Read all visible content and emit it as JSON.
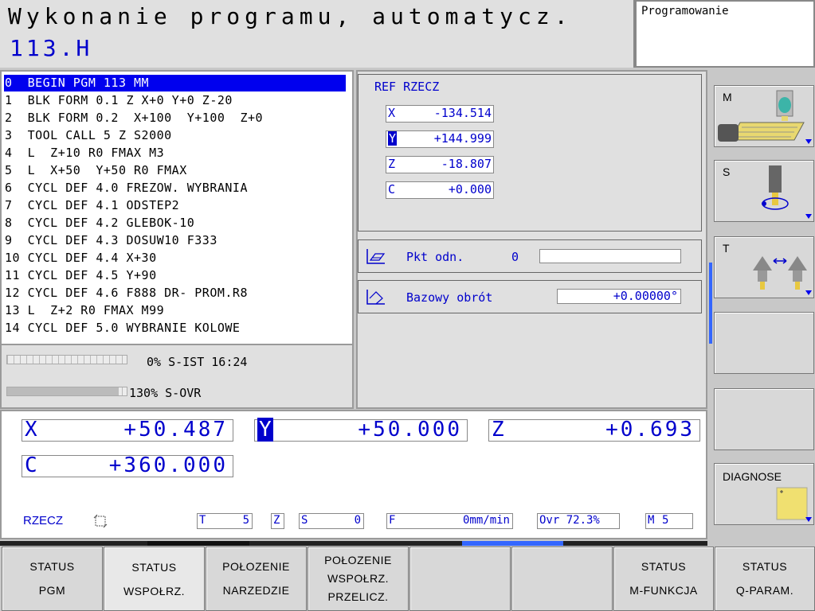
{
  "header": {
    "mode_title": "Wykonanie programu, automatycz.",
    "program_name": "113.H",
    "secondary_mode": "Programowanie"
  },
  "program": {
    "lines": [
      "0  BEGIN PGM 113 MM",
      "1  BLK FORM 0.1 Z X+0 Y+0 Z-20",
      "2  BLK FORM 0.2  X+100  Y+100  Z+0",
      "3  TOOL CALL 5 Z S2000",
      "4  L  Z+10 R0 FMAX M3",
      "5  L  X+50  Y+50 R0 FMAX",
      "6  CYCL DEF 4.0 FREZOW. WYBRANIA",
      "7  CYCL DEF 4.1 ODSTEP2",
      "8  CYCL DEF 4.2 GLEBOK-10",
      "9  CYCL DEF 4.3 DOSUW10 F333",
      "10 CYCL DEF 4.4 X+30",
      "11 CYCL DEF 4.5 Y+90",
      "12 CYCL DEF 4.6 F888 DR- PROM.R8",
      "13 L  Z+2 R0 FMAX M99",
      "14 CYCL DEF 5.0 WYBRANIE KOLOWE"
    ],
    "selected_line": 0
  },
  "progress": {
    "spindle_actual": "0% S-IST 16:24",
    "spindle_actual_fraction": 0.0,
    "spindle_override": "130% S-OVR",
    "spindle_override_fraction": 0.93
  },
  "status": {
    "ref_title": "REF RZECZ",
    "ref_axes": [
      {
        "axis": "X",
        "value": "-134.514"
      },
      {
        "axis": "Y",
        "value": "+144.999"
      },
      {
        "axis": "Z",
        "value": "-18.807"
      },
      {
        "axis": "C",
        "value": "+0.000"
      }
    ],
    "datum_label": "Pkt odn.",
    "datum_number": "0",
    "datum_value": "",
    "rotation_label": "Bazowy obrót",
    "rotation_value": "+0.00000°"
  },
  "position": {
    "axes": [
      {
        "axis": "X",
        "value": "+50.487"
      },
      {
        "axis": "Y",
        "value": "+50.000"
      },
      {
        "axis": "Z",
        "value": "+0.693"
      },
      {
        "axis": "C",
        "value": "+360.000"
      }
    ],
    "mode_label": "RZECZ",
    "tool_label": "T",
    "tool_value": "5",
    "axis_label": "Z",
    "spindle_label": "S",
    "spindle_value": "0",
    "feed_label": "F",
    "feed_value": "0mm/min",
    "override_text": "Ovr 72.3%",
    "mfunc_label": "M",
    "mfunc_value": "5"
  },
  "side_softkeys": [
    {
      "label": "M",
      "icon": "machine-table-icon"
    },
    {
      "label": "S",
      "icon": "spindle-icon"
    },
    {
      "label": "T",
      "icon": "tool-icon"
    },
    {
      "label": "",
      "icon": ""
    },
    {
      "label": "",
      "icon": ""
    },
    {
      "label": "DIAGNOSE",
      "icon": "diagnose-icon"
    }
  ],
  "bottom_softkeys": [
    {
      "line1": "STATUS",
      "line2": "PGM",
      "line3": ""
    },
    {
      "line1": "STATUS",
      "line2": "WSPOŁRZ.",
      "line3": ""
    },
    {
      "line1": "POŁOZENIE",
      "line2": "NARZEDZIE",
      "line3": ""
    },
    {
      "line1": "POŁOZENIE",
      "line2": "WSPOŁRZ.",
      "line3": "PRZELICZ."
    },
    {
      "line1": "",
      "line2": "",
      "line3": ""
    },
    {
      "line1": "",
      "line2": "",
      "line3": ""
    },
    {
      "line1": "STATUS",
      "line2": "M-FUNKCJA",
      "line3": ""
    },
    {
      "line1": "STATUS",
      "line2": "Q-PARAM.",
      "line3": ""
    }
  ],
  "colors": {
    "accent": "#0000cc",
    "selection": "#0000ee",
    "panel": "#e0e0e0",
    "softkey": "#d8d8d8"
  }
}
